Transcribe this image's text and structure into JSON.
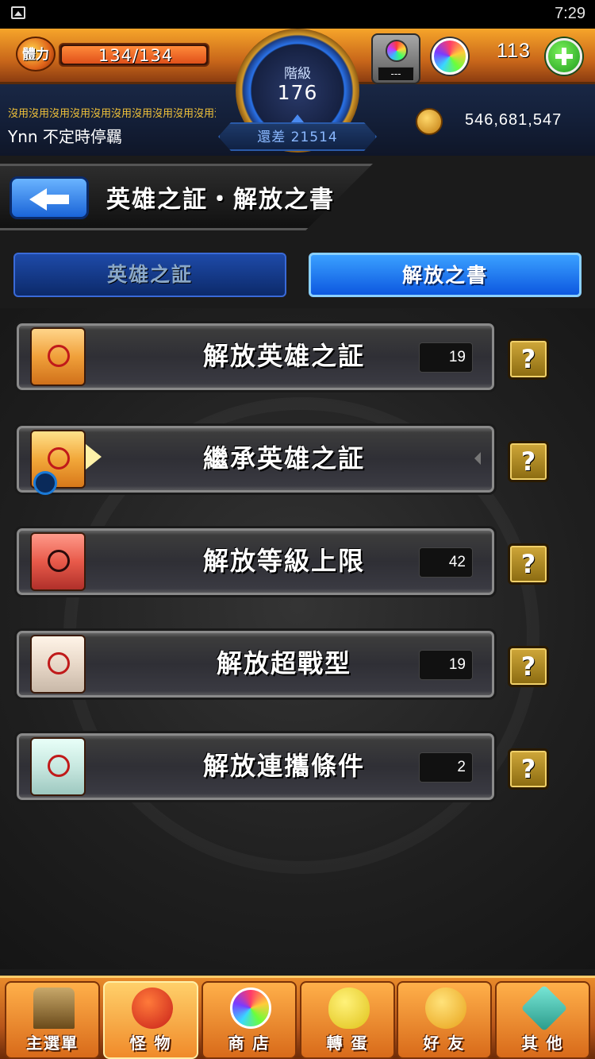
{
  "status_bar": {
    "time": "7:29"
  },
  "hud": {
    "stamina_label": "體力",
    "stamina_text": "134/134",
    "stamina_fraction": 1.0,
    "rank_label": "階級",
    "rank_value": "176",
    "exp_remaining": "還差 21514",
    "lab_text": "---",
    "orb_count": "113",
    "player_note": "沒用沒用沒用沒用沒用沒用沒用沒用沒用沒用沒用沒用沒用沒用沒用沒用",
    "player_name": "Ynn 不定時停羈",
    "coins": "546,681,547"
  },
  "page": {
    "title": "英雄之証・解放之書"
  },
  "tabs": [
    {
      "label": "英雄之証",
      "active": false
    },
    {
      "label": "解放之書",
      "active": true
    }
  ],
  "menu": [
    {
      "label": "解放英雄之証",
      "count": "19",
      "icon": "hero-proof-scroll-icon"
    },
    {
      "label": "繼承英雄之証",
      "count": "",
      "icon": "inherit-scroll-icon"
    },
    {
      "label": "解放等級上限",
      "count": "42",
      "icon": "level-cap-scroll-icon"
    },
    {
      "label": "解放超戰型",
      "count": "19",
      "icon": "super-battle-scroll-icon"
    },
    {
      "label": "解放連攜條件",
      "count": "2",
      "icon": "link-condition-scroll-icon"
    }
  ],
  "help_label": "?",
  "bottom_nav": [
    {
      "label": "主選單",
      "icon": "home-gate-icon",
      "active": false
    },
    {
      "label": "怪 物",
      "icon": "monster-icon",
      "active": true
    },
    {
      "label": "商 店",
      "icon": "shop-orb-icon",
      "active": false
    },
    {
      "label": "轉 蛋",
      "icon": "gacha-egg-icon",
      "active": false
    },
    {
      "label": "好 友",
      "icon": "friends-icon",
      "active": false
    },
    {
      "label": "其 他",
      "icon": "other-icon",
      "active": false
    }
  ],
  "colors": {
    "accent_blue": "#0d58e0",
    "nav_orange": "#e88a2a",
    "gold": "#f0c23a"
  }
}
